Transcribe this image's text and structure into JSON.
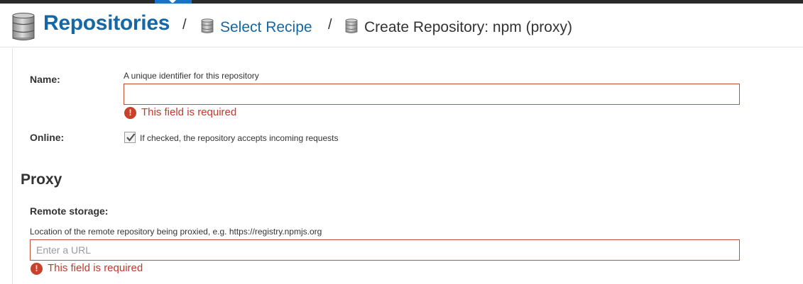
{
  "header": {
    "breadcrumb": {
      "root": "Repositories",
      "separator": "/",
      "recipe": "Select Recipe",
      "current": "Create Repository: npm (proxy)"
    }
  },
  "form": {
    "name": {
      "label": "Name:",
      "help": "A unique identifier for this repository",
      "value": "",
      "error": "This field is required"
    },
    "online": {
      "label": "Online:",
      "checked": true,
      "help": "If checked, the repository accepts incoming requests"
    },
    "proxy": {
      "title": "Proxy",
      "remote_storage": {
        "label": "Remote storage:",
        "help": "Location of the remote repository being proxied, e.g. https://registry.npmjs.org",
        "placeholder": "Enter a URL",
        "value": "",
        "error": "This field is required"
      }
    }
  },
  "icons": {
    "breadcrumb_root": "database-icon",
    "breadcrumb_recipe": "database-icon",
    "breadcrumb_current": "database-icon",
    "error": "exclamation-circle-icon",
    "checkbox": "checkmark-icon"
  },
  "colors": {
    "link": "#1567a6",
    "error": "#c0392b",
    "error_border": "#c0503a",
    "top_strip": "#2a2a2a",
    "active_tab": "#1a73c4"
  }
}
